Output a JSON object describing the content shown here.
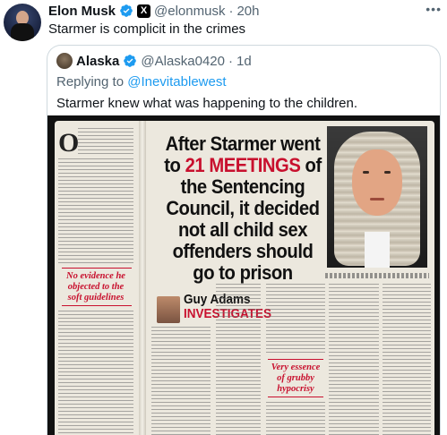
{
  "post": {
    "name": "Elon Musk",
    "handle": "@elonmusk",
    "separator": "·",
    "time": "20h",
    "text": "Starmer is complicit in the crimes",
    "more_icon": "ellipsis-icon",
    "badges": [
      "verified-badge-icon",
      "x-affiliate-badge-icon"
    ],
    "x_badge_glyph": "X"
  },
  "quoted_post": {
    "name": "Alaska",
    "handle": "@Alaska0420",
    "separator": "·",
    "time": "1d",
    "replying_to_prefix": "Replying to ",
    "replying_to_handle": "@Inevitablewest",
    "text": "Starmer knew what was happening to the children."
  },
  "newspaper_image": {
    "drop_cap": "O",
    "headline_part1": "After Starmer went to ",
    "headline_highlight": "21 MEETINGS",
    "headline_part2": " of the Sentencing Council, it decided not all child sex offenders should go to prison",
    "byline_name": "Guy Adams",
    "byline_tag": "INVESTIGATES",
    "pull_quote_1": "No evidence he\nobjected to the\nsoft guidelines",
    "pull_quote_2": "Very essence\nof grubby\nhypocrisy"
  },
  "colors": {
    "verified_blue": "#1d9bf0",
    "link_blue": "#1d9bf0",
    "muted_gray": "#536471",
    "headline_red": "#c8102e"
  }
}
